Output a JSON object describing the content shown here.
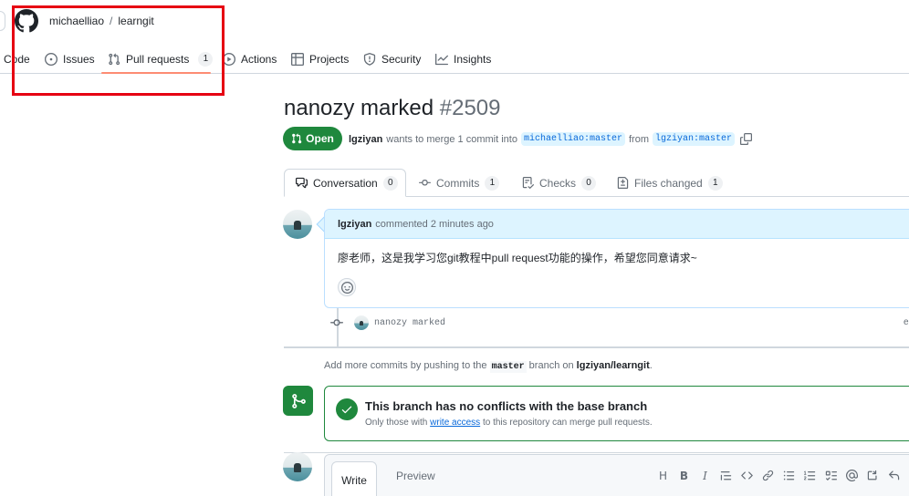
{
  "header": {
    "owner": "michaelliao",
    "separator": "/",
    "repo": "learngit"
  },
  "nav": {
    "code": "Code",
    "issues": "Issues",
    "pull_requests": "Pull requests",
    "pull_requests_count": "1",
    "actions": "Actions",
    "projects": "Projects",
    "security": "Security",
    "insights": "Insights"
  },
  "pr": {
    "title": "nanozy marked",
    "number": "#2509",
    "state": "Open",
    "author": "lgziyan",
    "merge_text": "wants to merge 1 commit into",
    "base_branch": "michaelliao:master",
    "from_text": "from",
    "head_branch": "lgziyan:master"
  },
  "tabs": {
    "conversation": "Conversation",
    "conversation_count": "0",
    "commits": "Commits",
    "commits_count": "1",
    "checks": "Checks",
    "checks_count": "0",
    "files_changed": "Files changed",
    "files_changed_count": "1"
  },
  "comment": {
    "author": "lgziyan",
    "meta": "commented 2 minutes ago",
    "body": "廖老师，这是我学习您git教程中pull request功能的操作，希望您同意请求~"
  },
  "commit": {
    "message": "nanozy marked",
    "hash_fragment": "e"
  },
  "push_hint": {
    "prefix": "Add more commits by pushing to the",
    "branch": "master",
    "middle": "branch on",
    "repo": "lgziyan/learngit",
    "suffix": "."
  },
  "merge": {
    "title": "This branch has no conflicts with the base branch",
    "sub_prefix": "Only those with",
    "sub_link": "write access",
    "sub_suffix": "to this repository can merge pull requests."
  },
  "editor": {
    "write": "Write",
    "preview": "Preview",
    "heading": "H",
    "bold": "B",
    "italic": "I"
  },
  "colors": {
    "open_green": "#1f883d",
    "link_blue": "#0969da",
    "nav_underline": "#fd8c73",
    "annotation_red": "#e60012"
  }
}
